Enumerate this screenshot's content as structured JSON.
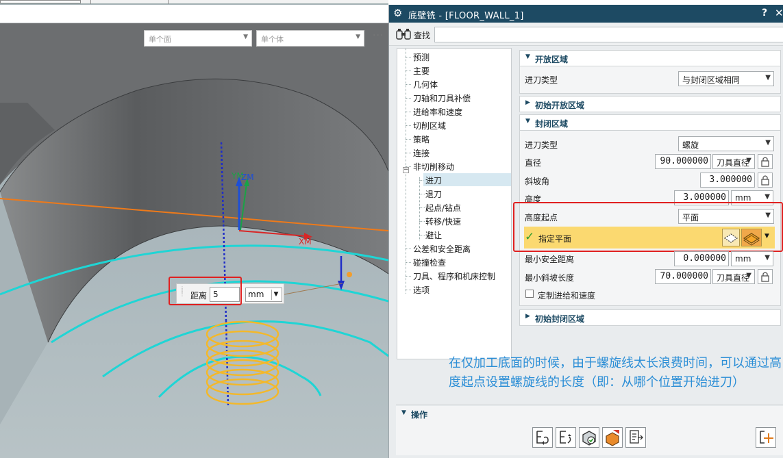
{
  "viewport": {
    "filter_face": "单个面",
    "filter_body": "单个体",
    "more": "···",
    "axis_ym": "YM",
    "axis_zm": "ZM",
    "axis_xm": "XM",
    "distance_label": "距离",
    "distance_value": "5",
    "distance_unit": "mm"
  },
  "dialog": {
    "title": "底壁铣 - [FLOOR_WALL_1]",
    "help": "?",
    "close": "✕",
    "find_label": "查找",
    "tree": [
      "预测",
      "主要",
      "几何体",
      "刀轴和刀具补偿",
      "进给率和速度",
      "切削区域",
      "策略",
      "连接",
      "非切削移动",
      "进刀",
      "退刀",
      "起点/钻点",
      "转移/快速",
      "避让",
      "公差和安全距离",
      "碰撞检查",
      "刀具、程序和机床控制",
      "选项"
    ],
    "open_area": {
      "header": "开放区域",
      "entry_type_label": "进刀类型",
      "entry_type_value": "与封闭区域相同"
    },
    "initial_open_header": "初始开放区域",
    "closed_area": {
      "header": "封闭区域",
      "entry_type_label": "进刀类型",
      "entry_type_value": "螺旋",
      "diameter_label": "直径",
      "diameter_value": "90.000000",
      "diameter_unit": "刀具直径",
      "ramp_angle_label": "斜坡角",
      "ramp_angle_value": "3.000000",
      "height_label": "高度",
      "height_value": "3.000000",
      "height_unit": "mm",
      "height_start_label": "高度起点",
      "height_start_value": "平面",
      "specify_plane_label": "指定平面",
      "min_safe_label": "最小安全距离",
      "min_safe_value": "0.000000",
      "min_safe_unit": "mm",
      "min_ramp_label": "最小斜坡长度",
      "min_ramp_value": "70.000000",
      "min_ramp_unit": "刀具直径",
      "custom_feed_label": "定制进给和速度"
    },
    "initial_closed_header": "初始封闭区域",
    "operations_header": "操作"
  },
  "annotation": "在仅加工底面的时候，由于螺旋线太长浪费时间，可以通过高度起点设置螺旋线的长度（即：从哪个位置开始进刀）"
}
